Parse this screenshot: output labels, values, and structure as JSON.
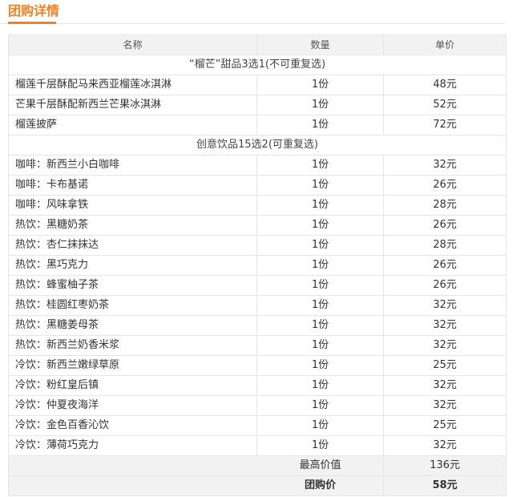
{
  "section": {
    "title": "团购详情"
  },
  "table": {
    "headers": {
      "name": "名称",
      "qty": "数量",
      "price": "单价"
    },
    "groups": [
      {
        "label": "“榴芒”甜品3选1(不可重复选)",
        "items": [
          {
            "name": "榴莲千层酥配马来西亚榴莲冰淇淋",
            "qty": "1份",
            "price": "48元"
          },
          {
            "name": "芒果千层酥配新西兰芒果冰淇淋",
            "qty": "1份",
            "price": "52元"
          },
          {
            "name": "榴莲披萨",
            "qty": "1份",
            "price": "72元"
          }
        ]
      },
      {
        "label": "创意饮品15选2(可重复选)",
        "items": [
          {
            "name": "咖啡：新西兰小白咖啡",
            "qty": "1份",
            "price": "32元"
          },
          {
            "name": "咖啡：卡布基诺",
            "qty": "1份",
            "price": "26元"
          },
          {
            "name": "咖啡：风味拿铁",
            "qty": "1份",
            "price": "28元"
          },
          {
            "name": "热饮：黑糖奶茶",
            "qty": "1份",
            "price": "26元"
          },
          {
            "name": "热饮：杏仁抹抹达",
            "qty": "1份",
            "price": "28元"
          },
          {
            "name": "热饮：黑巧克力",
            "qty": "1份",
            "price": "26元"
          },
          {
            "name": "热饮：蜂蜜柚子茶",
            "qty": "1份",
            "price": "26元"
          },
          {
            "name": "热饮：桂圆红枣奶茶",
            "qty": "1份",
            "price": "32元"
          },
          {
            "name": "热饮：黑糖姜母茶",
            "qty": "1份",
            "price": "32元"
          },
          {
            "name": "热饮：新西兰奶香米浆",
            "qty": "1份",
            "price": "32元"
          },
          {
            "name": "冷饮：新西兰嫩绿草原",
            "qty": "1份",
            "price": "25元"
          },
          {
            "name": "冷饮：粉红皇后镇",
            "qty": "1份",
            "price": "32元"
          },
          {
            "name": "冷饮：仲夏夜海洋",
            "qty": "1份",
            "price": "32元"
          },
          {
            "name": "冷饮：金色百香沁饮",
            "qty": "1份",
            "price": "25元"
          },
          {
            "name": "冷饮：薄荷巧克力",
            "qty": "1份",
            "price": "32元"
          }
        ]
      }
    ],
    "summary": {
      "max_label": "最高价值",
      "max_value": "136元",
      "deal_label": "团购价",
      "deal_value": "58元"
    }
  }
}
